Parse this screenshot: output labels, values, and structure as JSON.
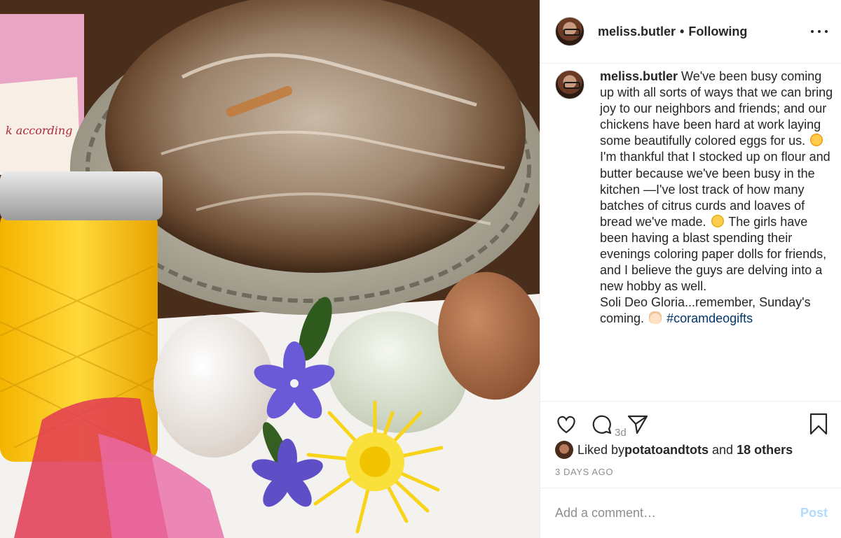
{
  "post": {
    "username": "meliss.butler",
    "separator": "•",
    "follow_status": "Following",
    "caption_user": "meliss.butler",
    "caption_p1": " We've been busy coming up with all sorts of ways that we can bring joy to our neighbors and friends; and our chickens have been hard at work laying some beautifully colored eggs for us.",
    "caption_p2": "I'm thankful that I stocked up on flour and butter because we've been busy in the kitchen —I've lost track of how many batches of citrus curds and loaves of bread we've made.",
    "caption_p3": " The girls have been having a blast spending their evenings coloring paper dolls for friends, and I believe the guys are delving into a new hobby as well.",
    "caption_p4": "Soli Deo Gloria...remember, Sunday's coming.",
    "hashtag": "#coramdeogifts",
    "time_ago": "3d"
  },
  "likes": {
    "prefix": "Liked by ",
    "liker": "potatoandtots",
    "and": " and ",
    "others": "18 others"
  },
  "date": "3 DAYS AGO",
  "comment": {
    "placeholder": "Add a comment…",
    "post_label": "Post"
  },
  "icons": {
    "more": "more-options-icon",
    "like": "heart-icon",
    "comment": "comment-bubble-icon",
    "share": "paper-plane-icon",
    "save": "bookmark-icon"
  },
  "colors": {
    "text": "#262626",
    "muted": "#8e8e8e",
    "hashtag": "#00376b",
    "post_disabled": "#b3dbff"
  }
}
